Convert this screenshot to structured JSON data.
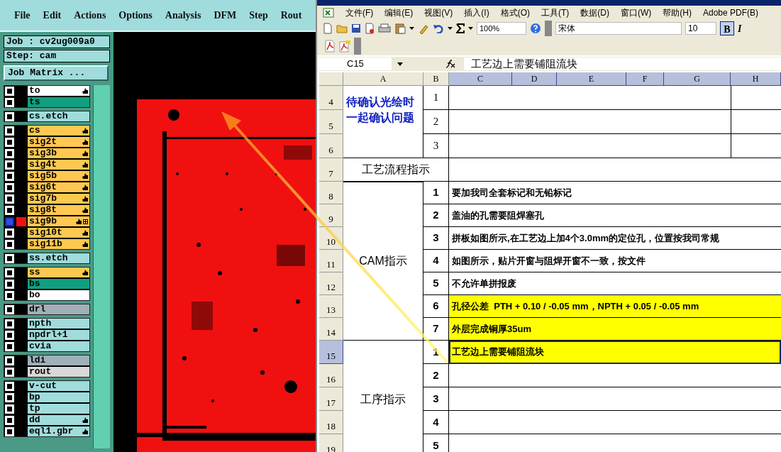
{
  "cam": {
    "menu": [
      "File",
      "Edit",
      "Actions",
      "Options",
      "Analysis",
      "DFM",
      "Step",
      "Rout"
    ],
    "job": "Job : cv2ug009a0",
    "step": "Step: cam",
    "matrix_button": "Job Matrix ...",
    "layer_groups": [
      {
        "layers": [
          {
            "name": "to",
            "color": "#ffffff",
            "hand": true,
            "selected": false
          },
          {
            "name": "ts",
            "color": "#10a080",
            "hand": false,
            "selected": false
          }
        ]
      },
      {
        "layers": [
          {
            "name": "cs.etch",
            "color": "#a0dcdc",
            "hand": false,
            "selected": false
          }
        ]
      },
      {
        "layers": [
          {
            "name": "cs",
            "color": "#ffc850",
            "hand": true,
            "selected": false
          },
          {
            "name": "sig2t",
            "color": "#ffc850",
            "hand": true,
            "selected": false
          },
          {
            "name": "sig3b",
            "color": "#ffc850",
            "hand": true,
            "selected": false
          },
          {
            "name": "sig4t",
            "color": "#ffc850",
            "hand": true,
            "selected": false
          },
          {
            "name": "sig5b",
            "color": "#ffc850",
            "hand": true,
            "selected": false
          },
          {
            "name": "sig6t",
            "color": "#ffc850",
            "hand": true,
            "selected": false
          },
          {
            "name": "sig7b",
            "color": "#ffc850",
            "hand": true,
            "selected": false
          },
          {
            "name": "sig8t",
            "color": "#ffc850",
            "hand": true,
            "selected": false
          },
          {
            "name": "sig9b",
            "color": "#ffc850",
            "hand": true,
            "selected": true,
            "boxed": true
          },
          {
            "name": "sig10t",
            "color": "#ffc850",
            "hand": true,
            "selected": false
          },
          {
            "name": "sig11b",
            "color": "#ffc850",
            "hand": true,
            "selected": false
          }
        ]
      },
      {
        "layers": [
          {
            "name": "ss.etch",
            "color": "#a0dcdc",
            "hand": false,
            "selected": false
          }
        ]
      },
      {
        "layers": [
          {
            "name": "ss",
            "color": "#ffc850",
            "hand": true,
            "selected": false
          },
          {
            "name": "bs",
            "color": "#10a080",
            "hand": false,
            "selected": false
          },
          {
            "name": "bo",
            "color": "#ffffff",
            "hand": false,
            "selected": false
          }
        ]
      },
      {
        "layers": [
          {
            "name": "drl",
            "color": "#a0b0b8",
            "hand": false,
            "selected": false
          }
        ]
      },
      {
        "layers": [
          {
            "name": "npth",
            "color": "#a0dcdc",
            "hand": false,
            "selected": false
          },
          {
            "name": "npdrl+1",
            "color": "#a0dcdc",
            "hand": false,
            "selected": false
          },
          {
            "name": "cvia",
            "color": "#a0dcdc",
            "hand": false,
            "selected": false
          }
        ]
      },
      {
        "layers": [
          {
            "name": "ldi",
            "color": "#a0b0b8",
            "hand": false,
            "selected": false
          },
          {
            "name": "rout",
            "color": "#d8d8d8",
            "hand": false,
            "selected": false
          }
        ]
      },
      {
        "layers": [
          {
            "name": "v-cut",
            "color": "#a0dcdc",
            "hand": false,
            "selected": false
          },
          {
            "name": "bp",
            "color": "#a0dcdc",
            "hand": false,
            "selected": false
          },
          {
            "name": "tp",
            "color": "#a0dcdc",
            "hand": false,
            "selected": false
          },
          {
            "name": "dd",
            "color": "#a0dcdc",
            "hand": true,
            "selected": false
          },
          {
            "name": "eql1.gbr",
            "color": "#a0dcdc",
            "hand": true,
            "selected": false
          }
        ]
      }
    ]
  },
  "excel": {
    "menu": [
      "文件(F)",
      "编辑(E)",
      "视图(V)",
      "插入(I)",
      "格式(O)",
      "工具(T)",
      "数据(D)",
      "窗口(W)",
      "帮助(H)",
      "Adobe PDF(B)"
    ],
    "zoom": "100%",
    "font": "宋体",
    "font_size": "10",
    "bold_button": "B",
    "bold_on": true,
    "italic_button": "I",
    "name_box": "C15",
    "formula": "工艺边上需要铺阻流块",
    "columns": [
      {
        "label": "A",
        "selected": false
      },
      {
        "label": "B",
        "selected": false
      },
      {
        "label": "C",
        "selected": true
      },
      {
        "label": "D",
        "selected": true
      },
      {
        "label": "E",
        "selected": true
      },
      {
        "label": "F",
        "selected": true
      },
      {
        "label": "G",
        "selected": true
      },
      {
        "label": "H",
        "selected": true
      }
    ],
    "rows": [
      {
        "label": "4",
        "selected": false
      },
      {
        "label": "5",
        "selected": false
      },
      {
        "label": "6",
        "selected": false
      },
      {
        "label": "7",
        "selected": false
      },
      {
        "label": "8",
        "selected": false
      },
      {
        "label": "9",
        "selected": false
      },
      {
        "label": "10",
        "selected": false
      },
      {
        "label": "11",
        "selected": false
      },
      {
        "label": "12",
        "selected": false
      },
      {
        "label": "13",
        "selected": false
      },
      {
        "label": "14",
        "selected": false
      },
      {
        "label": "15",
        "selected": true
      },
      {
        "label": "16",
        "selected": false
      },
      {
        "label": "17",
        "selected": false
      },
      {
        "label": "18",
        "selected": false
      },
      {
        "label": "19",
        "selected": false
      }
    ],
    "sections": [
      {
        "kind": "pending",
        "title": "待确认光绘时一起确认问题",
        "items": [
          {
            "number": "1"
          },
          {
            "number": "2"
          },
          {
            "number": "3"
          }
        ]
      },
      {
        "kind": "heading",
        "title": "工艺流程指示"
      },
      {
        "kind": "list",
        "title": "CAM指示",
        "items": [
          {
            "number": "1",
            "text": "要加我司全套标记和无铅标记",
            "highlighted": false
          },
          {
            "number": "2",
            "text": "盖油的孔需要阻焊塞孔",
            "highlighted": false
          },
          {
            "number": "3",
            "text": "拼板如图所示,在工艺边上加4个3.0mm的定位孔，位置按我司常规",
            "highlighted": false
          },
          {
            "number": "4",
            "text": "如图所示，贴片开窗与阻焊开窗不一致，按文件",
            "highlighted": false
          },
          {
            "number": "5",
            "text": "不允许单拼报废",
            "highlighted": false
          },
          {
            "number": "6",
            "text": "孔径公差  PTH + 0.10 / -0.05 mm，NPTH + 0.05 / -0.05 mm",
            "highlighted": true
          },
          {
            "number": "7",
            "text": "外层完成铜厚35um",
            "highlighted": true
          }
        ]
      },
      {
        "kind": "list",
        "title": "工序指示",
        "items": [
          {
            "number": "1",
            "text": "工艺边上需要铺阻流块",
            "highlighted": true
          },
          {
            "number": "2"
          },
          {
            "number": "3"
          },
          {
            "number": "4"
          },
          {
            "number": "5"
          }
        ]
      }
    ]
  }
}
